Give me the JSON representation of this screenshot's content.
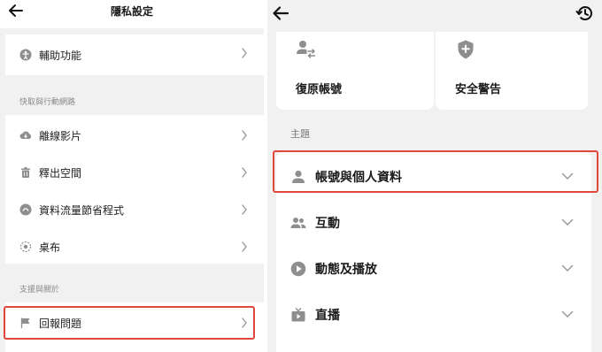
{
  "left_panel": {
    "title": "隱私設定",
    "icons": {
      "back": "back-arrow-icon",
      "accessibility": "accessibility-icon",
      "offline": "cloud-download-icon",
      "trash": "trash-icon",
      "data_saver": "data-saver-icon",
      "wallpaper": "wallpaper-icon",
      "flag": "flag-icon",
      "chevron": "chevron-right-icon"
    },
    "top_item": {
      "label": "輔助功能"
    },
    "section_cache": {
      "header": "快取與行動網路",
      "items": [
        {
          "label": "離線影片"
        },
        {
          "label": "釋出空間"
        },
        {
          "label": "資料流量節省程式"
        },
        {
          "label": "桌布"
        }
      ]
    },
    "section_support": {
      "header": "支援與關於",
      "items": [
        {
          "label": "回報問題"
        }
      ]
    }
  },
  "right_panel": {
    "icons": {
      "back": "back-arrow-icon",
      "history": "history-icon",
      "restore": "switch-account-icon",
      "security": "shield-plus-icon",
      "person": "person-icon",
      "people": "people-icon",
      "play": "play-circle-icon",
      "live": "live-tv-icon",
      "chevron": "chevron-down-icon"
    },
    "tiles": [
      {
        "label": "復原帳號"
      },
      {
        "label": "安全警告"
      }
    ],
    "topics_header": "主題",
    "topics": [
      {
        "label": "帳號與個人資料"
      },
      {
        "label": "互動"
      },
      {
        "label": "動態及播放"
      },
      {
        "label": "直播"
      }
    ]
  },
  "colors": {
    "highlight": "#e2473b",
    "background": "#f1f1f2",
    "icon_gray": "#8e8e8e"
  }
}
